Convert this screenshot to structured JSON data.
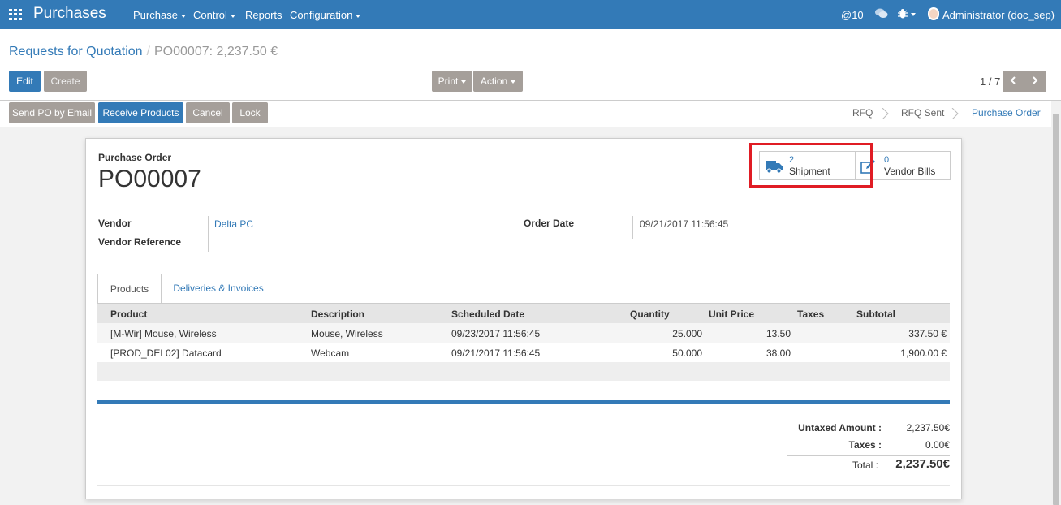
{
  "app": {
    "title": "Purchases"
  },
  "nav": {
    "menu": [
      {
        "label": "Purchase",
        "dropdown": true
      },
      {
        "label": "Control",
        "dropdown": true
      },
      {
        "label": "Reports",
        "dropdown": false
      },
      {
        "label": "Configuration",
        "dropdown": true
      }
    ],
    "mentions": "@10",
    "user": "Administrator (doc_sep)"
  },
  "breadcrumb": {
    "parent": "Requests for Quotation",
    "current": "PO00007: 2,237.50 €"
  },
  "buttons": {
    "edit": "Edit",
    "create": "Create",
    "print": "Print",
    "action": "Action"
  },
  "pager": {
    "value": "1 / 7"
  },
  "header_buttons": {
    "send_po": "Send PO by Email",
    "receive": "Receive Products",
    "cancel": "Cancel",
    "lock": "Lock"
  },
  "statusbar": {
    "stages": [
      "RFQ",
      "RFQ Sent",
      "Purchase Order"
    ],
    "active": "Purchase Order"
  },
  "form": {
    "doc_label": "Purchase Order",
    "name": "PO00007",
    "vendor_label": "Vendor",
    "vendor_value": "Delta PC",
    "vendor_ref_label": "Vendor Reference",
    "order_date_label": "Order Date",
    "order_date_value": "09/21/2017 11:56:45"
  },
  "smart_buttons": {
    "shipment": {
      "count": "2",
      "label": "Shipment"
    },
    "bills": {
      "count": "0",
      "label": "Vendor Bills"
    }
  },
  "tabs": [
    "Products",
    "Deliveries & Invoices"
  ],
  "table": {
    "columns": [
      "Product",
      "Description",
      "Scheduled Date",
      "Quantity",
      "Unit Price",
      "Taxes",
      "Subtotal"
    ],
    "rows": [
      {
        "product": "[M-Wir] Mouse, Wireless",
        "description": "Mouse, Wireless",
        "date": "09/23/2017 11:56:45",
        "qty": "25.000",
        "price": "13.50",
        "taxes": "",
        "subtotal": "337.50 €"
      },
      {
        "product": "[PROD_DEL02] Datacard",
        "description": "Webcam",
        "date": "09/21/2017 11:56:45",
        "qty": "50.000",
        "price": "38.00",
        "taxes": "",
        "subtotal": "1,900.00 €"
      }
    ]
  },
  "totals": {
    "untaxed_label": "Untaxed Amount :",
    "untaxed_value": "2,237.50€",
    "taxes_label": "Taxes :",
    "taxes_value": "0.00€",
    "total_label": "Total :",
    "total_value": "2,237.50€"
  },
  "colors": {
    "primary": "#337ab7",
    "secondary": "#a59f9a",
    "highlight": "#e01c24"
  }
}
